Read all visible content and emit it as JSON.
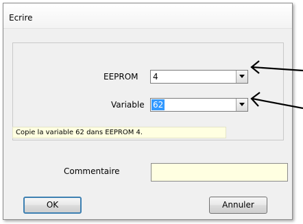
{
  "window": {
    "title": "Ecrire"
  },
  "form": {
    "eeprom_label": "EEPROM",
    "eeprom_value": "4",
    "variable_label": "Variable",
    "variable_value": "62",
    "info_text": "Copie la variable 62 dans EEPROM 4.",
    "comment_label": "Commentaire",
    "comment_value": ""
  },
  "buttons": {
    "ok": "OK",
    "cancel": "Annuler"
  },
  "colors": {
    "info_bg": "#ffffe1",
    "selection": "#3399ff"
  },
  "icons": {
    "dropdown": "chevron-down-icon",
    "annotation": "arrow-left-icon"
  }
}
